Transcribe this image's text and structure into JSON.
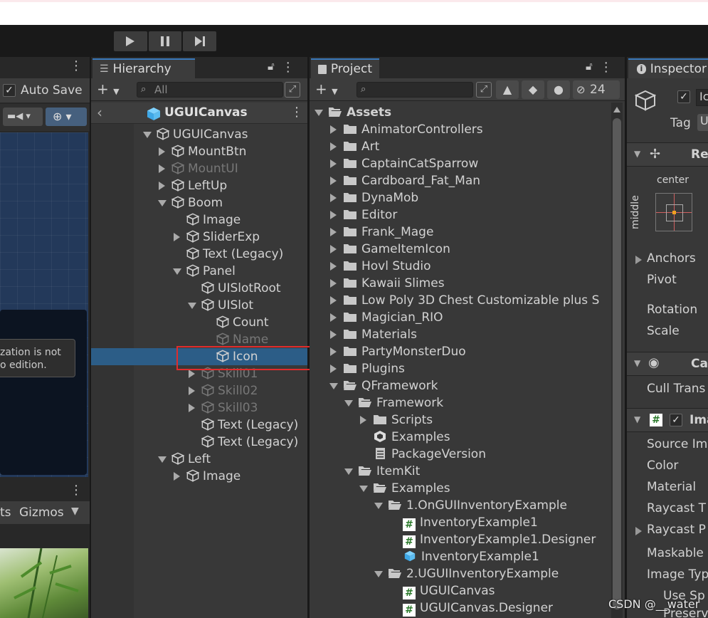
{
  "toolbar": {
    "play": "play-icon",
    "pause": "pause-icon",
    "step": "step-icon"
  },
  "scene_panel": {
    "auto_save_label": "Auto Save",
    "tooltip_line1": "zation is not",
    "tooltip_line2": "o edition.",
    "game_toolbar_left": "ts",
    "gizmos_label": "Gizmos"
  },
  "hierarchy": {
    "tab_title": "Hierarchy",
    "search_placeholder": "All",
    "root_label": "UGUICanvas",
    "items": [
      {
        "label": "UGUICanvas",
        "depth": 0,
        "arrow": "down",
        "dim": false
      },
      {
        "label": "MountBtn",
        "depth": 1,
        "arrow": "right",
        "dim": false
      },
      {
        "label": "MountUI",
        "depth": 1,
        "arrow": "right",
        "dim": true
      },
      {
        "label": "LeftUp",
        "depth": 1,
        "arrow": "right",
        "dim": false
      },
      {
        "label": "Boom",
        "depth": 1,
        "arrow": "down",
        "dim": false
      },
      {
        "label": "Image",
        "depth": 2,
        "arrow": "none",
        "dim": false
      },
      {
        "label": "SliderExp",
        "depth": 2,
        "arrow": "right",
        "dim": false
      },
      {
        "label": "Text (Legacy)",
        "depth": 2,
        "arrow": "none",
        "dim": false
      },
      {
        "label": "Panel",
        "depth": 2,
        "arrow": "down",
        "dim": false
      },
      {
        "label": "UISlotRoot",
        "depth": 3,
        "arrow": "none",
        "dim": false
      },
      {
        "label": "UISlot",
        "depth": 3,
        "arrow": "down",
        "dim": false
      },
      {
        "label": "Count",
        "depth": 4,
        "arrow": "none",
        "dim": false
      },
      {
        "label": "Name",
        "depth": 4,
        "arrow": "none",
        "dim": true
      },
      {
        "label": "Icon",
        "depth": 4,
        "arrow": "none",
        "dim": false,
        "selected": true
      },
      {
        "label": "Skill01",
        "depth": 3,
        "arrow": "right",
        "dim": true
      },
      {
        "label": "Skill02",
        "depth": 3,
        "arrow": "right",
        "dim": true
      },
      {
        "label": "Skill03",
        "depth": 3,
        "arrow": "right",
        "dim": true
      },
      {
        "label": "Text (Legacy)",
        "depth": 3,
        "arrow": "none",
        "dim": false
      },
      {
        "label": "Text (Legacy)",
        "depth": 3,
        "arrow": "none",
        "dim": false
      },
      {
        "label": "Left",
        "depth": 1,
        "arrow": "down",
        "dim": false
      },
      {
        "label": "Image",
        "depth": 2,
        "arrow": "right",
        "dim": false
      }
    ]
  },
  "project": {
    "tab_title": "Project",
    "hidden_count": "24",
    "items": [
      {
        "label": "Assets",
        "depth": 0,
        "arrow": "down",
        "icon": "folder-open",
        "bold": true
      },
      {
        "label": "AnimatorControllers",
        "depth": 1,
        "arrow": "right",
        "icon": "folder"
      },
      {
        "label": "Art",
        "depth": 1,
        "arrow": "right",
        "icon": "folder"
      },
      {
        "label": "CaptainCatSparrow",
        "depth": 1,
        "arrow": "right",
        "icon": "folder"
      },
      {
        "label": "Cardboard_Fat_Man",
        "depth": 1,
        "arrow": "right",
        "icon": "folder"
      },
      {
        "label": "DynaMob",
        "depth": 1,
        "arrow": "right",
        "icon": "folder"
      },
      {
        "label": "Editor",
        "depth": 1,
        "arrow": "right",
        "icon": "folder"
      },
      {
        "label": "Frank_Mage",
        "depth": 1,
        "arrow": "right",
        "icon": "folder"
      },
      {
        "label": "GameItemIcon",
        "depth": 1,
        "arrow": "right",
        "icon": "folder"
      },
      {
        "label": "Hovl Studio",
        "depth": 1,
        "arrow": "right",
        "icon": "folder"
      },
      {
        "label": "Kawaii Slimes",
        "depth": 1,
        "arrow": "right",
        "icon": "folder"
      },
      {
        "label": "Low Poly 3D Chest Customizable plus S",
        "depth": 1,
        "arrow": "right",
        "icon": "folder"
      },
      {
        "label": "Magician_RIO",
        "depth": 1,
        "arrow": "right",
        "icon": "folder"
      },
      {
        "label": "Materials",
        "depth": 1,
        "arrow": "right",
        "icon": "folder"
      },
      {
        "label": "PartyMonsterDuo",
        "depth": 1,
        "arrow": "right",
        "icon": "folder"
      },
      {
        "label": "Plugins",
        "depth": 1,
        "arrow": "right",
        "icon": "folder"
      },
      {
        "label": "QFramework",
        "depth": 1,
        "arrow": "down",
        "icon": "folder-open"
      },
      {
        "label": "Framework",
        "depth": 2,
        "arrow": "down",
        "icon": "folder-open"
      },
      {
        "label": "Scripts",
        "depth": 3,
        "arrow": "right",
        "icon": "folder"
      },
      {
        "label": "Examples",
        "depth": 3,
        "arrow": "none",
        "icon": "unity"
      },
      {
        "label": "PackageVersion",
        "depth": 3,
        "arrow": "none",
        "icon": "doc"
      },
      {
        "label": "ItemKit",
        "depth": 2,
        "arrow": "down",
        "icon": "folder-open"
      },
      {
        "label": "Examples",
        "depth": 3,
        "arrow": "down",
        "icon": "folder-open"
      },
      {
        "label": "1.OnGUIInventoryExample",
        "depth": 4,
        "arrow": "down",
        "icon": "folder-open"
      },
      {
        "label": "InventoryExample1",
        "depth": 5,
        "arrow": "none",
        "icon": "script"
      },
      {
        "label": "InventoryExample1.Designer",
        "depth": 5,
        "arrow": "none",
        "icon": "script"
      },
      {
        "label": "InventoryExample1",
        "depth": 5,
        "arrow": "none",
        "icon": "prefab"
      },
      {
        "label": "2.UGUIInventoryExample",
        "depth": 4,
        "arrow": "down",
        "icon": "folder-open"
      },
      {
        "label": "UGUICanvas",
        "depth": 5,
        "arrow": "none",
        "icon": "script"
      },
      {
        "label": "UGUICanvas.Designer",
        "depth": 5,
        "arrow": "none",
        "icon": "script"
      }
    ]
  },
  "inspector": {
    "tab_title": "Inspector",
    "name_value": "Ic",
    "tag_label": "Tag",
    "tag_value": "U",
    "rect_section": "Re",
    "anchor_h": "center",
    "anchor_v": "middle",
    "props1": [
      "Anchors",
      "Pivot",
      "Rotation",
      "Scale"
    ],
    "canvas_section": "Ca",
    "cull_label": "Cull Trans",
    "image_section": "Ima",
    "props2": [
      "Source Im",
      "Color",
      "Material",
      "Raycast T",
      "Raycast P",
      "Maskable",
      "Image Typ",
      "Use Sp",
      "Preserv"
    ]
  },
  "watermark": "CSDN @__water"
}
